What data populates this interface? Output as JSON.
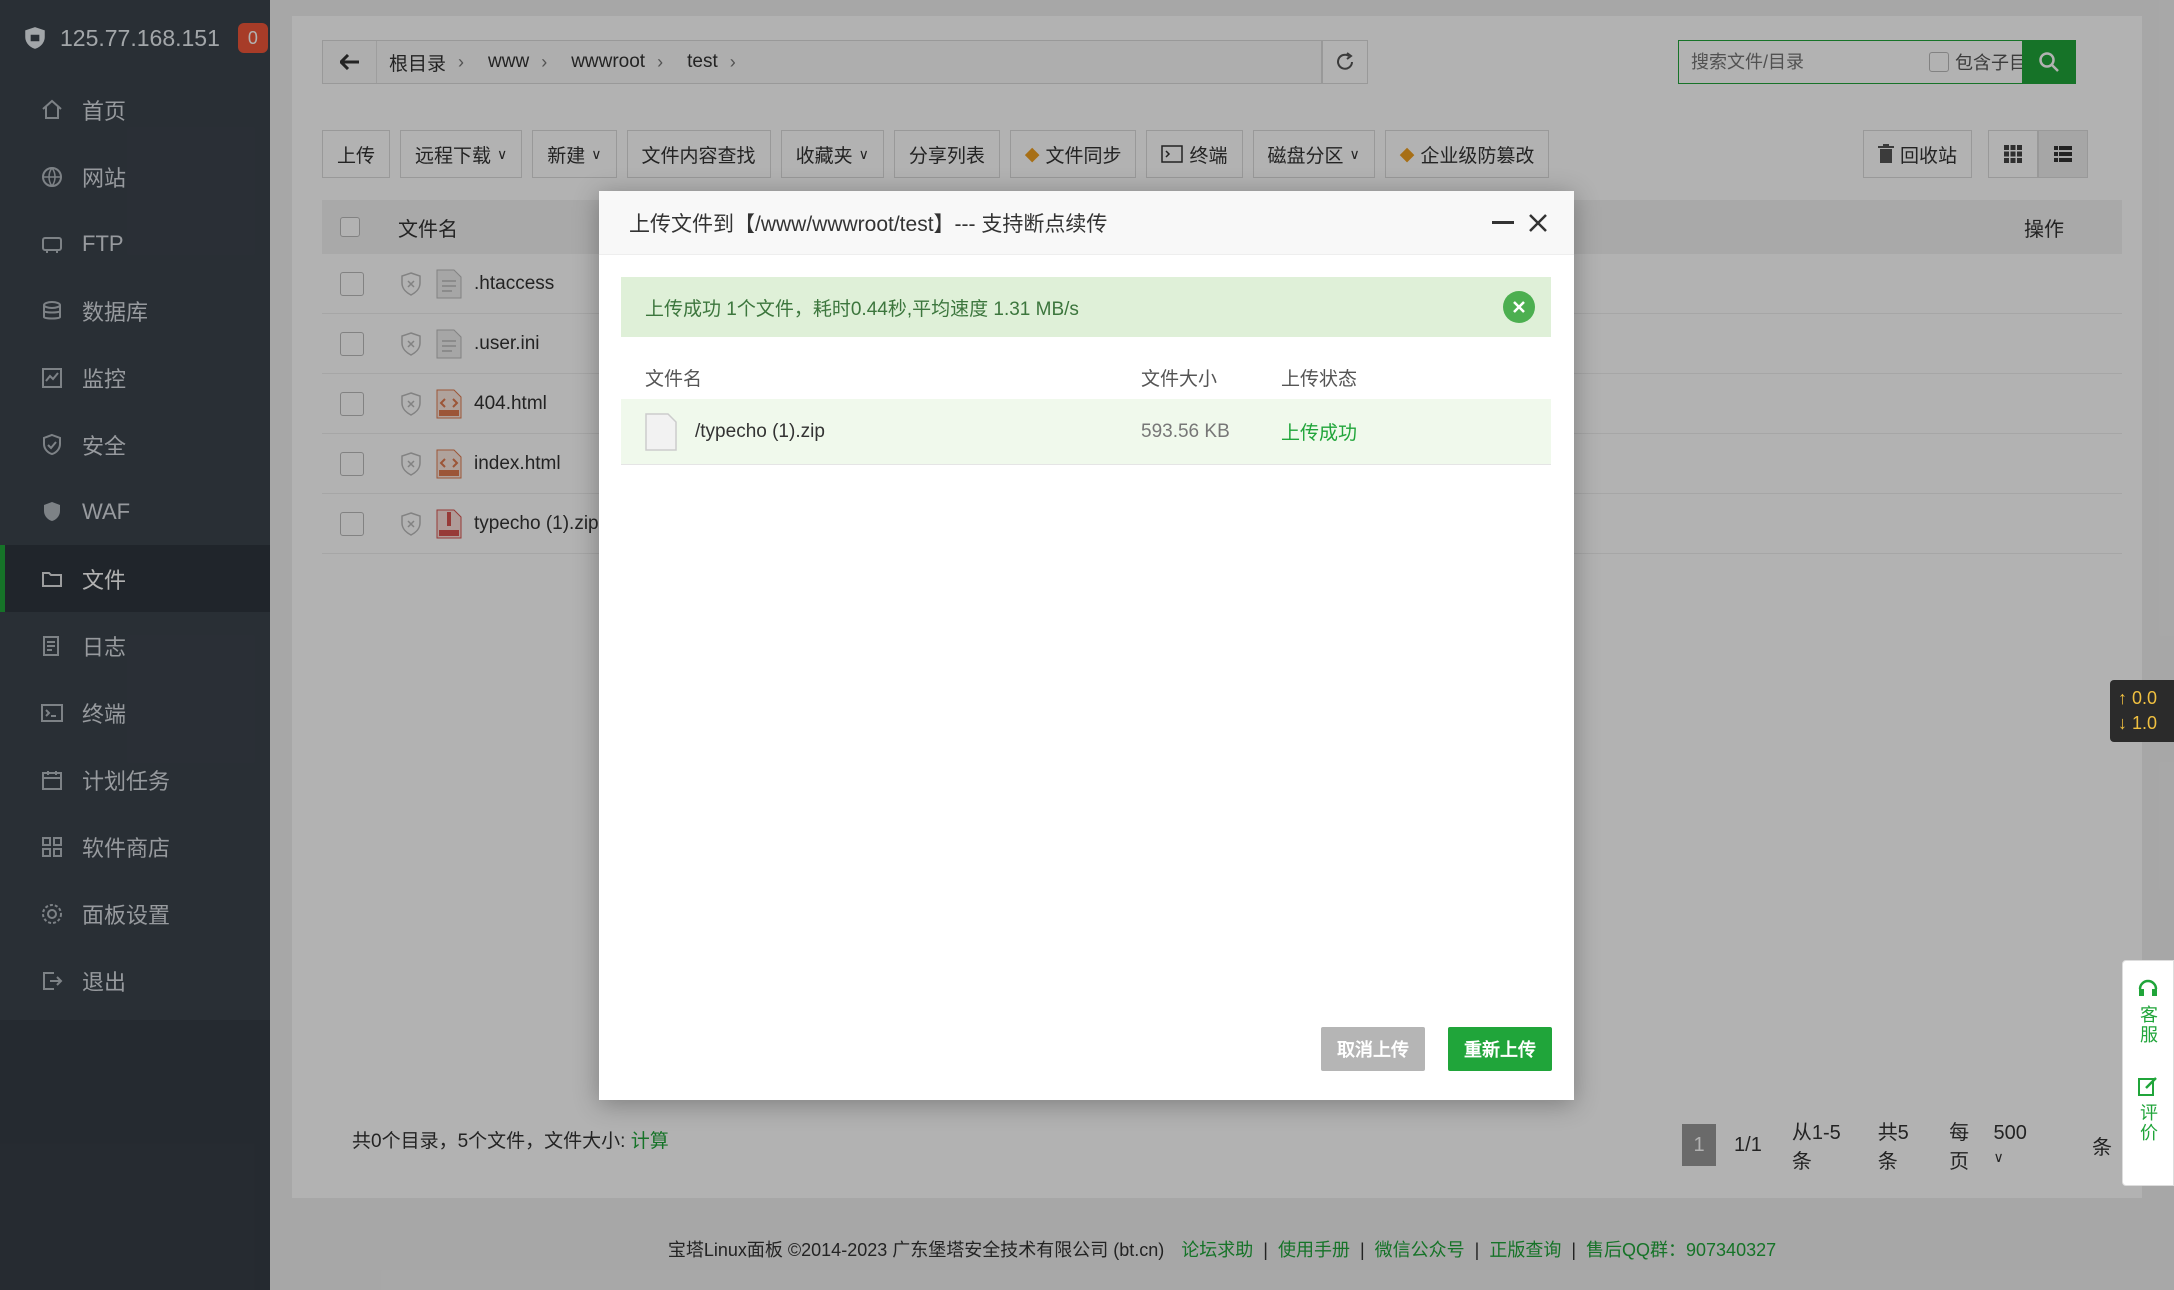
{
  "sidebar": {
    "server_ip": "125.77.168.151",
    "badge_count": "0",
    "items": [
      {
        "label": "首页",
        "icon": "home-icon"
      },
      {
        "label": "网站",
        "icon": "globe-icon"
      },
      {
        "label": "FTP",
        "icon": "ftp-icon"
      },
      {
        "label": "数据库",
        "icon": "database-icon"
      },
      {
        "label": "监控",
        "icon": "monitor-icon"
      },
      {
        "label": "安全",
        "icon": "shield-icon"
      },
      {
        "label": "WAF",
        "icon": "waf-icon"
      },
      {
        "label": "文件",
        "icon": "folder-icon"
      },
      {
        "label": "日志",
        "icon": "log-icon"
      },
      {
        "label": "终端",
        "icon": "terminal-icon"
      },
      {
        "label": "计划任务",
        "icon": "calendar-icon"
      },
      {
        "label": "软件商店",
        "icon": "apps-icon"
      },
      {
        "label": "面板设置",
        "icon": "settings-icon"
      },
      {
        "label": "退出",
        "icon": "logout-icon"
      }
    ],
    "active_index": 7
  },
  "path": {
    "crumbs": [
      "根目录",
      "www",
      "wwwroot",
      "test"
    ]
  },
  "search": {
    "placeholder": "搜索文件/目录",
    "include_subdir_label": "包含子目录"
  },
  "toolbar": {
    "upload": "上传",
    "remote_download": "远程下载",
    "new": "新建",
    "content_search": "文件内容查找",
    "favorites": "收藏夹",
    "share_list": "分享列表",
    "file_sync": "文件同步",
    "terminal": "终端",
    "disk_partition": "磁盘分区",
    "tamper_proof": "企业级防篡改",
    "recycle_bin": "回收站"
  },
  "table": {
    "col_name": "文件名",
    "col_ops": "操作",
    "files": [
      {
        "name": ".htaccess",
        "type": "text"
      },
      {
        "name": ".user.ini",
        "type": "text"
      },
      {
        "name": "404.html",
        "type": "html"
      },
      {
        "name": "index.html",
        "type": "html"
      },
      {
        "name": "typecho (1).zip",
        "type": "zip"
      }
    ]
  },
  "footer_stats": {
    "summary": "共0个目录，5个文件，文件大小:",
    "calc_link": "计算"
  },
  "pager": {
    "current": "1",
    "pages": "1/1",
    "range": "从1-5条",
    "total": "共5条",
    "per_page_label": "每页",
    "per_page_value": "500",
    "unit": "条"
  },
  "site_footer": {
    "copyright": "宝塔Linux面板 ©2014-2023 广东堡塔安全技术有限公司 (bt.cn)",
    "links": [
      "论坛求助",
      "使用手册",
      "微信公众号",
      "正版查询",
      "售后QQ群：907340327"
    ]
  },
  "netspeed": {
    "up": "0.0",
    "down": "1.0"
  },
  "side_service": {
    "service": "客服",
    "review": "评价"
  },
  "dialog": {
    "title": "上传文件到【/www/wwwroot/test】--- 支持断点续传",
    "success_message": "上传成功 1个文件，耗时0.44秒,平均速度 1.31 MB/s",
    "col_name": "文件名",
    "col_size": "文件大小",
    "col_status": "上传状态",
    "rows": [
      {
        "name": "/typecho (1).zip",
        "size": "593.56 KB",
        "status": "上传成功"
      }
    ],
    "cancel_label": "取消上传",
    "reupload_label": "重新上传"
  },
  "colors": {
    "accent": "#20a53a",
    "sidebar_bg": "#3c444d",
    "badge": "#f0573a",
    "success_bg": "#dff0d8"
  }
}
